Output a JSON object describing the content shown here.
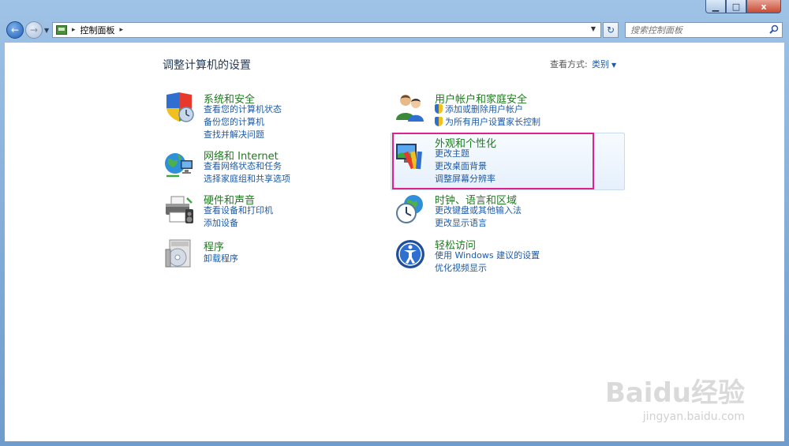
{
  "window": {
    "min_label": "▁",
    "max_label": "□",
    "close_label": "x"
  },
  "nav": {
    "back_glyph": "←",
    "forward_glyph": "→",
    "history_glyph": "▼",
    "breadcrumb": [
      "控制面板"
    ],
    "separator": "▸",
    "refresh_glyph": "↻",
    "search_placeholder": "搜索控制面板"
  },
  "header": {
    "title": "调整计算机的设置",
    "view_by_label": "查看方式:",
    "view_by_value": "类别"
  },
  "categories_left": [
    {
      "title": "系统和安全",
      "icon": "shield-clock-icon",
      "links": [
        "查看您的计算机状态",
        "备份您的计算机",
        "查找并解决问题"
      ]
    },
    {
      "title": "网络和 Internet",
      "icon": "globe-network-icon",
      "links": [
        "查看网络状态和任务",
        "选择家庭组和共享选项"
      ]
    },
    {
      "title": "硬件和声音",
      "icon": "printer-speaker-icon",
      "links": [
        "查看设备和打印机",
        "添加设备"
      ]
    },
    {
      "title": "程序",
      "icon": "programs-disk-icon",
      "links": [
        "卸载程序"
      ]
    }
  ],
  "categories_right": [
    {
      "title": "用户帐户和家庭安全",
      "icon": "users-icon",
      "links": [
        "添加或删除用户帐户",
        "为所有用户设置家长控制"
      ],
      "shielded": true
    },
    {
      "title": "外观和个性化",
      "icon": "monitor-paint-icon",
      "links": [
        "更改主题",
        "更改桌面背景",
        "调整屏幕分辨率"
      ]
    },
    {
      "title": "时钟、语言和区域",
      "icon": "clock-globe-icon",
      "links": [
        "更改键盘或其他输入法",
        "更改显示语言"
      ]
    },
    {
      "title": "轻松访问",
      "icon": "ease-of-access-icon",
      "links": [
        "使用 Windows 建议的设置",
        "优化视频显示"
      ]
    }
  ],
  "watermark": {
    "logo": "Baidu经验",
    "url": "jingyan.baidu.com"
  }
}
